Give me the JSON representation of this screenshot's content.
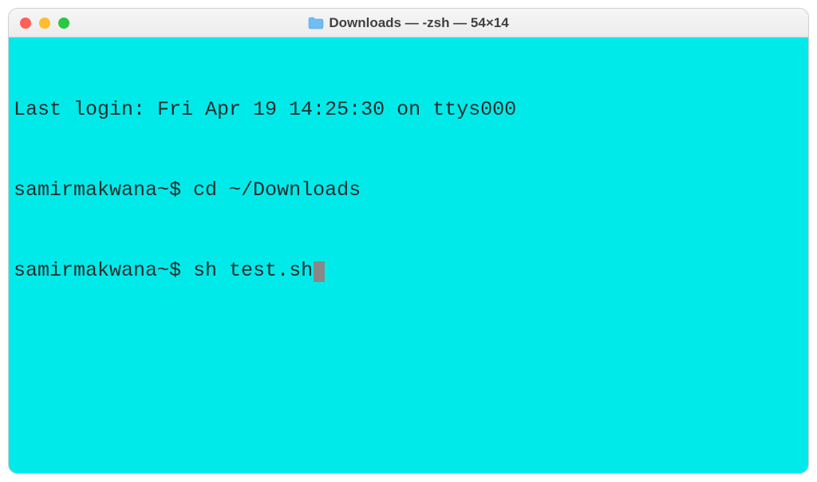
{
  "window": {
    "title": "Downloads — -zsh — 54×14"
  },
  "terminal": {
    "lines": [
      {
        "text": "Last login: Fri Apr 19 14:25:30 on ttys000"
      },
      {
        "prompt": "samirmakwana~$ ",
        "command": "cd ~/Downloads"
      },
      {
        "prompt": "samirmakwana~$ ",
        "command": "sh test.sh",
        "cursor": true
      }
    ]
  }
}
